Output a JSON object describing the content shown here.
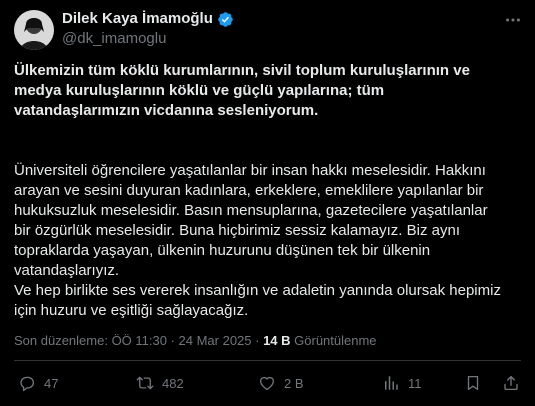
{
  "author": {
    "display_name": "Dilek Kaya İmamoğlu",
    "handle": "@dk_imamoglu",
    "verified": true
  },
  "tweet": {
    "bold_lines": [
      "Ülkemizin tüm köklü kurumlarının, sivil toplum kuruluşlarının ve",
      "medya kuruluşlarının köklü ve güçlü yapılarına; tüm",
      "vatandaşlarımızın vicdanına sesleniyorum."
    ],
    "lines": [
      "Üniversiteli öğrencilere yaşatılanlar bir insan hakkı meselesidir. Hakkını",
      "arayan ve sesini duyuran kadınlara, erkeklere, emeklilere yapılanlar bir",
      "hukuksuzluk meselesidir. Basın mensuplarına, gazetecilere yaşatılanlar",
      "bir özgürlük meselesidir. Buna hiçbirimiz sessiz kalamayız. Biz aynı",
      "topraklarda yaşayan, ülkenin huzurunu düşünen tek bir ülkenin",
      "vatandaşlarıyız.",
      "Ve hep birlikte ses vererek insanlığın ve adaletin yanında olursak hepimiz",
      "için huzuru ve eşitliği sağlayacağız."
    ]
  },
  "meta": {
    "edited_timestamp": "Son düzenleme: ÖÖ 11:30 · 24 Mar 2025 · ",
    "views_count": "14 B",
    "views_label": " Görüntülenme"
  },
  "actions": {
    "replies": "47",
    "reposts": "482",
    "likes": "2 B",
    "views": "11"
  },
  "colors": {
    "background": "#000000",
    "text": "#e7e9ea",
    "secondary": "#71767b",
    "verified": "#1d9bf0"
  }
}
